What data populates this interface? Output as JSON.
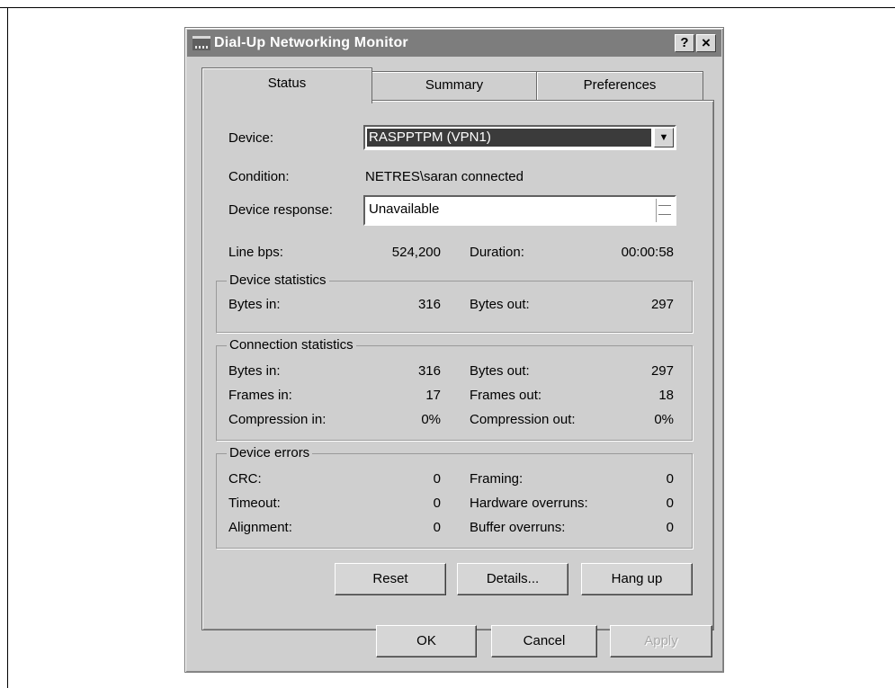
{
  "window": {
    "title": "Dial-Up Networking Monitor",
    "help_label": "?",
    "close_label": "×"
  },
  "tabs": [
    {
      "label": "Status",
      "active": true
    },
    {
      "label": "Summary",
      "active": false
    },
    {
      "label": "Preferences",
      "active": false
    }
  ],
  "status": {
    "device_label": "Device:",
    "device_value": "RASPPTPM (VPN1)",
    "condition_label": "Condition:",
    "condition_value": "NETRES\\saran connected",
    "device_response_label": "Device response:",
    "device_response_value": "Unavailable",
    "line_bps_label": "Line bps:",
    "line_bps_value": "524,200",
    "duration_label": "Duration:",
    "duration_value": "00:00:58"
  },
  "device_statistics": {
    "title": "Device statistics",
    "bytes_in_label": "Bytes in:",
    "bytes_in_value": "316",
    "bytes_out_label": "Bytes out:",
    "bytes_out_value": "297"
  },
  "connection_statistics": {
    "title": "Connection statistics",
    "bytes_in_label": "Bytes in:",
    "bytes_in_value": "316",
    "bytes_out_label": "Bytes out:",
    "bytes_out_value": "297",
    "frames_in_label": "Frames in:",
    "frames_in_value": "17",
    "frames_out_label": "Frames out:",
    "frames_out_value": "18",
    "compression_in_label": "Compression in:",
    "compression_in_value": "0%",
    "compression_out_label": "Compression out:",
    "compression_out_value": "0%"
  },
  "device_errors": {
    "title": "Device errors",
    "crc_label": "CRC:",
    "crc_value": "0",
    "timeout_label": "Timeout:",
    "timeout_value": "0",
    "alignment_label": "Alignment:",
    "alignment_value": "0",
    "framing_label": "Framing:",
    "framing_value": "0",
    "hardware_overruns_label": "Hardware overruns:",
    "hardware_overruns_value": "0",
    "buffer_overruns_label": "Buffer overruns:",
    "buffer_overruns_value": "0"
  },
  "actions": {
    "reset_label": "Reset",
    "details_label": "Details...",
    "hangup_label": "Hang up"
  },
  "footer": {
    "ok_label": "OK",
    "cancel_label": "Cancel",
    "apply_label": "Apply"
  }
}
